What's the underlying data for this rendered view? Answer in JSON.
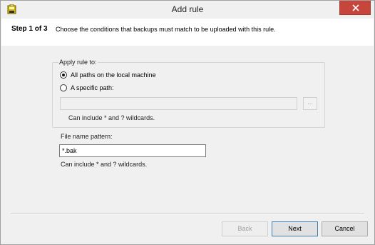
{
  "window": {
    "title": "Add rule",
    "close_color": "#c7463c"
  },
  "header": {
    "step": "Step 1 of 3",
    "description": "Choose the conditions that backups must match to be uploaded with this rule."
  },
  "apply_rule": {
    "label": "Apply rule to:",
    "option_all": "All paths on the local machine",
    "option_specific": "A specific path:",
    "selected": "All paths on the local machine",
    "path_value": "",
    "browse_label": "...",
    "hint": "Can include * and ? wildcards."
  },
  "pattern": {
    "label": "File name pattern:",
    "value": "*.bak",
    "hint": "Can include * and ? wildcards."
  },
  "buttons": {
    "back": "Back",
    "next": "Next",
    "cancel": "Cancel"
  },
  "icons": {
    "app": "backup-app-icon",
    "close": "close-icon"
  }
}
